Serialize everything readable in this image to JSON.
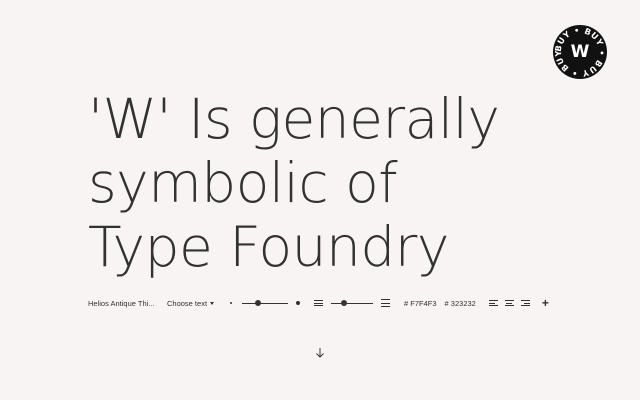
{
  "badge": {
    "letter": "W",
    "ring_text": "BUY • BUY • BUY • BUY •"
  },
  "headline": {
    "lines": [
      "'W' Is generally",
      "symbolic of",
      "Type Foundry"
    ]
  },
  "toolbar": {
    "font_name": "Helios Antique Thi...",
    "choose_text": "Choose text",
    "size_slider_value": 0.35,
    "spacing_slider_value": 0.3,
    "background_color_label": "# F7F4F3",
    "text_color_label": "# 323232",
    "plus_label": "+"
  },
  "colors": {
    "background": "#F7F4F3",
    "text": "#323232",
    "badge": "#111111"
  },
  "icons": {
    "scroll_down": "arrow-down-icon"
  }
}
